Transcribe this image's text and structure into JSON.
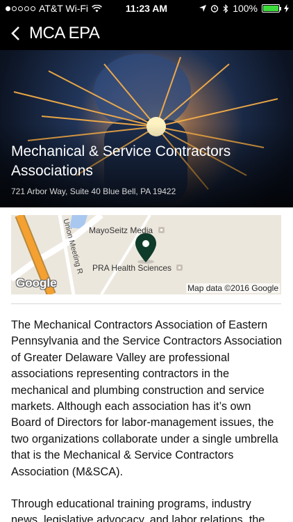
{
  "status_bar": {
    "carrier": "AT&T Wi-Fi",
    "time": "11:23 AM",
    "battery": "100%",
    "signal_bars_filled": 1,
    "battery_level": 1.0
  },
  "nav": {
    "title": "MCA EPA",
    "back_label": "‹"
  },
  "hero": {
    "title": "Mechanical & Service Contractors Associations",
    "address": "721 Arbor Way, Suite 40 Blue Bell, PA 19422"
  },
  "map": {
    "place_1": "MayoSeitz Media",
    "place_2": "PRA Health Sciences",
    "road_label": "Union Meeting R",
    "logo": "Google",
    "attribution": "Map data ©2016 Google"
  },
  "description": {
    "p1": "The Mechanical Contractors Association of Eastern Pennsylvania and the Service Contractors Association of Greater Delaware Valley are professional associations representing contractors in the mechanical and plumbing construction and service markets. Although each association has it’s own Board of Directors for labor-management issues, the two organizations collaborate under a single umbrella that is the Mechanical & Service Contractors Association (M&SCA).",
    "p2": "Through educational training programs, industry news, legislative advocacy, and labor relations, the"
  },
  "colors": {
    "nav_background": "#000000",
    "battery_fill": "#3ddc3d",
    "map_pin": "#0f3b2a",
    "map_road": "#f4a131",
    "map_water": "#a9c8f0"
  }
}
